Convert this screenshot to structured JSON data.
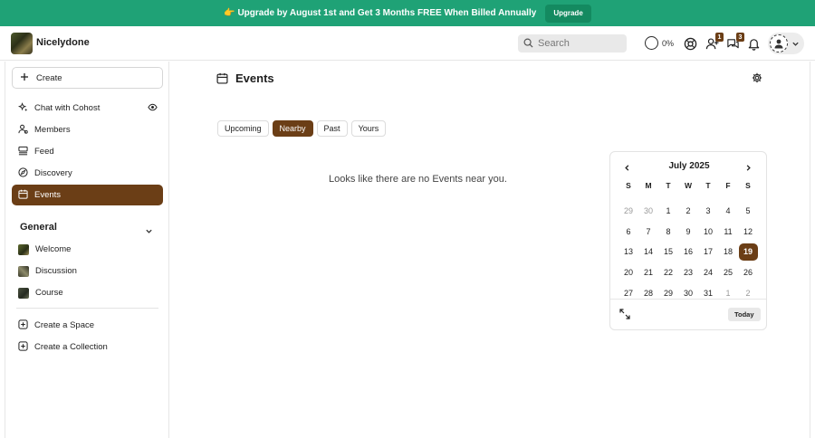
{
  "banner": {
    "text": "👉 Upgrade by August 1st and Get 3 Months FREE When Billed Annually",
    "button_label": "Upgrade"
  },
  "header": {
    "site_name": "Nicelydone",
    "search_placeholder": "Search",
    "progress_label": "0%",
    "progress_value": 0,
    "invites_badge": "1",
    "chat_badge": "3"
  },
  "sidebar": {
    "create_label": "Create",
    "items": [
      {
        "label": "Chat with Cohost",
        "icon": "sparkle-icon"
      },
      {
        "label": "Members",
        "icon": "members-icon"
      },
      {
        "label": "Feed",
        "icon": "feed-icon"
      },
      {
        "label": "Discovery",
        "icon": "compass-icon"
      },
      {
        "label": "Events",
        "icon": "calendar-icon",
        "active": true
      }
    ],
    "section_title": "General",
    "spaces": [
      {
        "label": "Welcome"
      },
      {
        "label": "Discussion"
      },
      {
        "label": "Course"
      }
    ],
    "actions": [
      {
        "label": "Create a Space"
      },
      {
        "label": "Create a Collection"
      }
    ]
  },
  "main": {
    "title": "Events",
    "tabs": [
      "Upcoming",
      "Nearby",
      "Past",
      "Yours"
    ],
    "active_tab": "Nearby",
    "empty_message": "Looks like there are no Events near you."
  },
  "calendar": {
    "title": "July 2025",
    "weekdays": [
      "S",
      "M",
      "T",
      "W",
      "T",
      "F",
      "S"
    ],
    "days": [
      "29",
      "30",
      "1",
      "2",
      "3",
      "4",
      "5",
      "6",
      "7",
      "8",
      "9",
      "10",
      "11",
      "12",
      "13",
      "14",
      "15",
      "16",
      "17",
      "18",
      "19",
      "20",
      "21",
      "22",
      "23",
      "24",
      "25",
      "26",
      "27",
      "28",
      "29",
      "30",
      "31",
      "1",
      "2"
    ],
    "muted_indices": [
      0,
      1,
      33,
      34
    ],
    "selected_index": 20,
    "today_label": "Today"
  },
  "colors": {
    "banner": "#1fa276",
    "accent": "#6b3e16"
  }
}
